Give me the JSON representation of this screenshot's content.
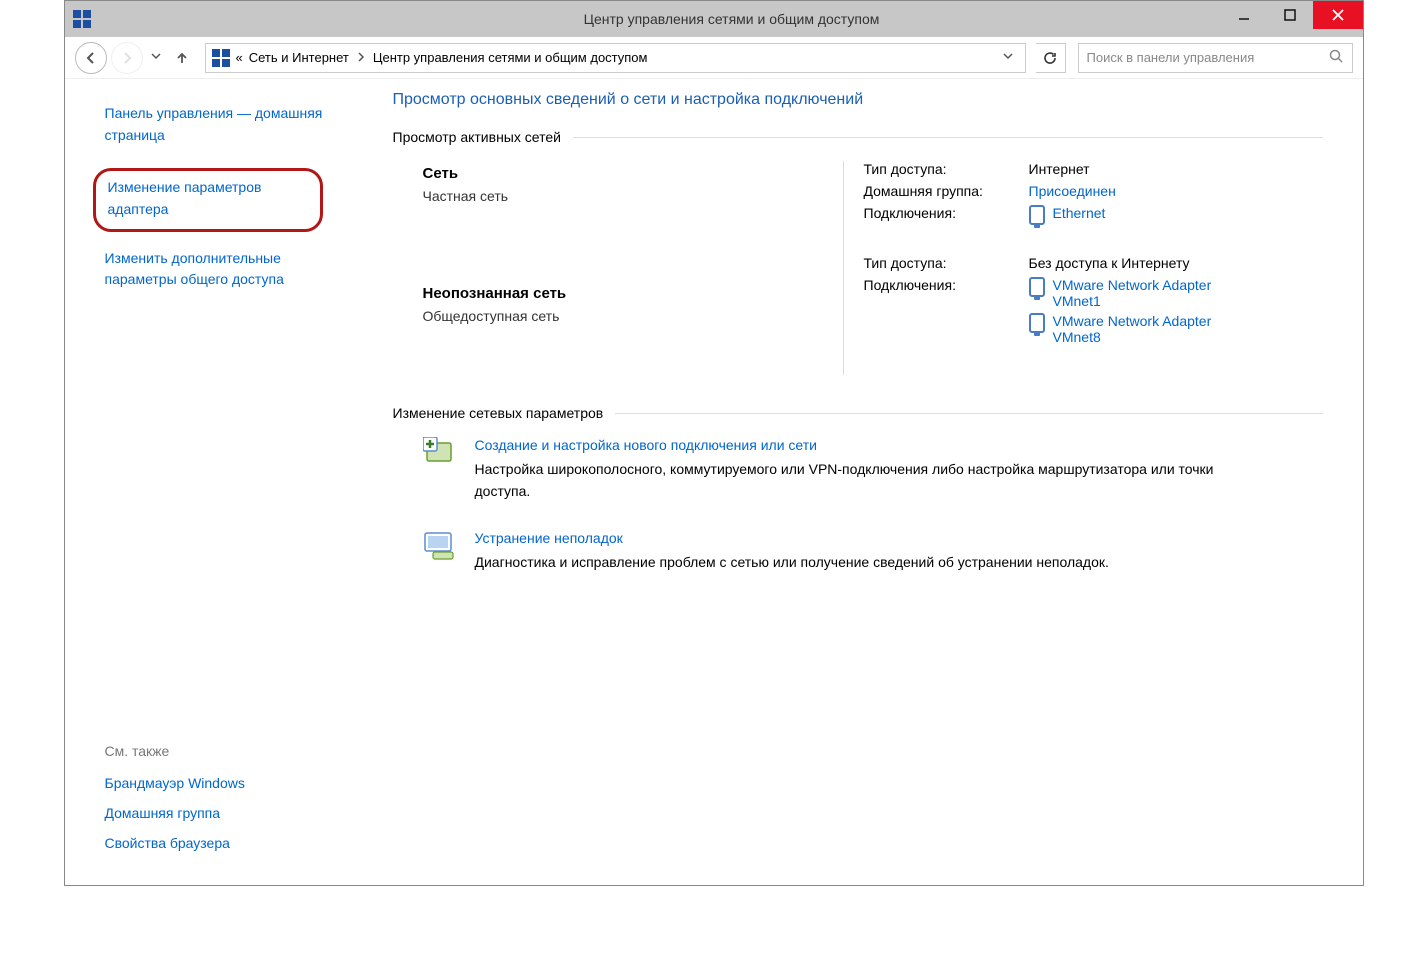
{
  "titlebar": {
    "title": "Центр управления сетями и общим доступом"
  },
  "nav": {
    "breadcrumb_prefix": "«",
    "crumb1": "Сеть и Интернет",
    "crumb2": "Центр управления сетями и общим доступом",
    "search_placeholder": "Поиск в панели управления"
  },
  "sidebar": {
    "home": "Панель управления — домашняя страница",
    "adapter": "Изменение параметров адаптера",
    "advanced": "Изменить дополнительные параметры общего доступа",
    "see_also": "См. также",
    "firewall": "Брандмауэр Windows",
    "homegroup": "Домашняя группа",
    "browser": "Свойства браузера"
  },
  "main": {
    "heading": "Просмотр основных сведений о сети и настройка подключений",
    "active_networks": "Просмотр активных сетей",
    "change_settings": "Изменение сетевых параметров",
    "net1": {
      "name": "Сеть",
      "type": "Частная сеть",
      "access_key": "Тип доступа:",
      "access_val": "Интернет",
      "homegroup_key": "Домашняя группа:",
      "homegroup_val": "Присоединен",
      "conn_key": "Подключения:",
      "conn1": "Ethernet"
    },
    "net2": {
      "name": "Неопознанная сеть",
      "type": "Общедоступная сеть",
      "access_key": "Тип доступа:",
      "access_val": "Без доступа к Интернету",
      "conn_key": "Подключения:",
      "conn1": "VMware Network Adapter VMnet1",
      "conn2": "VMware Network Adapter VMnet8"
    },
    "change1": {
      "title": "Создание и настройка нового подключения или сети",
      "desc": "Настройка широкополосного, коммутируемого или VPN-подключения либо настройка маршрутизатора или точки доступа."
    },
    "change2": {
      "title": "Устранение неполадок",
      "desc": "Диагностика и исправление проблем с сетью или получение сведений об устранении неполадок."
    }
  }
}
